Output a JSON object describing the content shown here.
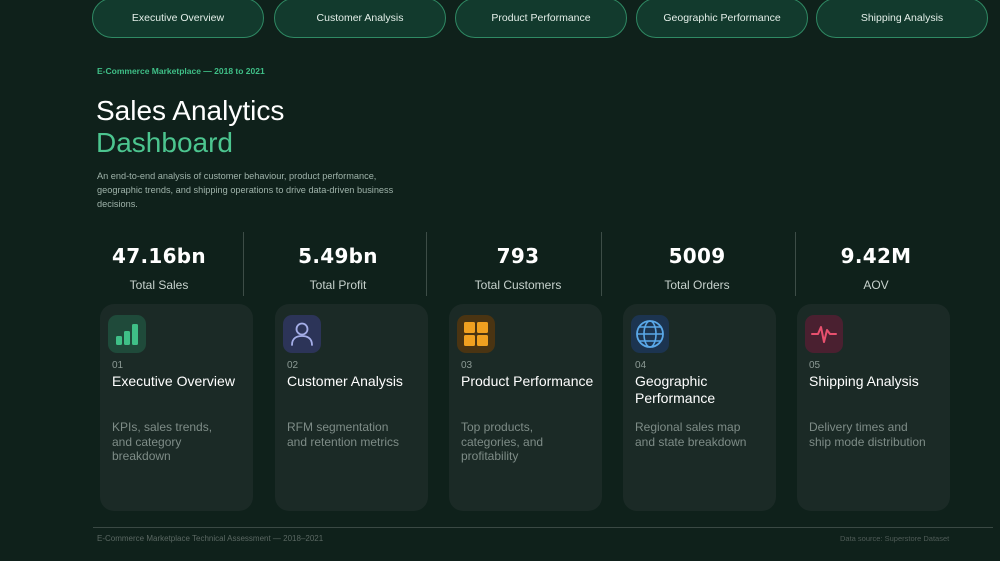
{
  "nav": {
    "tabs": [
      {
        "label": "Executive Overview"
      },
      {
        "label": "Customer Analysis"
      },
      {
        "label": "Product Performance"
      },
      {
        "label": "Geographic Performance"
      },
      {
        "label": "Shipping Analysis"
      }
    ]
  },
  "hero": {
    "subtitle": "E-Commerce Marketplace — 2018 to 2021",
    "title_line1": "Sales Analytics",
    "title_line2": "Dashboard",
    "description": "An end-to-end analysis of customer behaviour, product performance, geographic trends, and shipping operations to drive data-driven business decisions."
  },
  "kpis": [
    {
      "value": "47.16bn",
      "label": "Total Sales"
    },
    {
      "value": "5.49bn",
      "label": "Total Profit"
    },
    {
      "value": "793",
      "label": "Total Customers"
    },
    {
      "value": "5009",
      "label": "Total Orders"
    },
    {
      "value": "9.42M",
      "label": "AOV"
    }
  ],
  "cards": [
    {
      "num": "01",
      "title": "Executive Overview",
      "desc": "KPIs, sales trends, and category breakdown",
      "icon": "bar-chart-icon",
      "color": "#3fbf87"
    },
    {
      "num": "02",
      "title": "Customer Analysis",
      "desc": "RFM segmentation and retention metrics",
      "icon": "person-icon",
      "color": "#8e9ae0"
    },
    {
      "num": "03",
      "title": "Product Performance",
      "desc": "Top products, categories, and profitability",
      "icon": "grid-icon",
      "color": "#f0a020"
    },
    {
      "num": "04",
      "title": "Geographic Performance",
      "desc": "Regional sales map and state breakdown",
      "icon": "globe-icon",
      "color": "#5aa8e8"
    },
    {
      "num": "05",
      "title": "Shipping Analysis",
      "desc": "Delivery times and ship mode distribution",
      "icon": "pulse-icon",
      "color": "#e8506e"
    }
  ],
  "footer": {
    "left": "E-Commerce Marketplace Technical Assessment — 2018–2021",
    "right": "Data source: Superstore Dataset"
  },
  "colors": {
    "background": "#0f211b",
    "accent": "#4cc58f",
    "card": "#1b2a26"
  }
}
